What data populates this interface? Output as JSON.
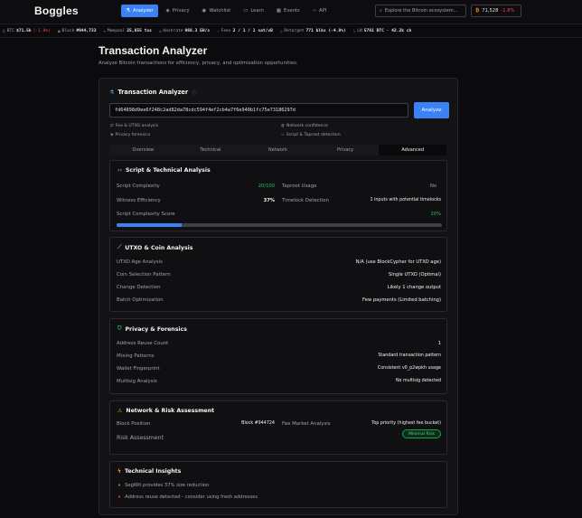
{
  "nav": {
    "logo": "Boggles",
    "links": [
      {
        "label": "Analyzer",
        "icon": "flask"
      },
      {
        "label": "Privacy",
        "icon": "shield"
      },
      {
        "label": "Watchlist",
        "icon": "eye"
      },
      {
        "label": "Learn",
        "icon": "book"
      },
      {
        "label": "Events",
        "icon": "calendar"
      },
      {
        "label": "API",
        "icon": "code"
      }
    ],
    "search_placeholder": "Explore the Bitcoin ecosystem...",
    "price": "71,528",
    "price_change": "-1.8%"
  },
  "ticker": {
    "btc_label": "BTC",
    "btc_value": "$71.5k",
    "btc_change": "(-1.8%)",
    "block_label": "Block",
    "block_value": "#944,733",
    "mempool_label": "Mempool",
    "mempool_value": "25,655 txs",
    "hashrate_label": "Hashrate",
    "hashrate_value": "968.3 EH/s",
    "fees_label": "Fees",
    "fees_value": "2 / 1 / 1 sat/vB",
    "retarget_label": "Retarget",
    "retarget_value": "771 blks (-4.8%)",
    "ln_label": "LN",
    "ln_value": "5781 BTC · 42.2k ch"
  },
  "page": {
    "title": "Transaction Analyzer",
    "subtitle": "Analyze Bitcoin transactions for efficiency, privacy, and optimization opportunities."
  },
  "analyzer": {
    "title": "Transaction Analyzer",
    "txid": "fd64898d9ee6f248c2ad82da78cdc594f4ef2cb4a7f6e940b1fc75e73186297d",
    "analyze_label": "Analyze",
    "features": [
      "Fee & UTXO analysis",
      "Network confidence",
      "Privacy forensics",
      "Script & Taproot detection"
    ],
    "tabs": [
      "Overview",
      "Technical",
      "Network",
      "Privacy",
      "Advanced"
    ],
    "active_tab": "Advanced"
  },
  "script": {
    "title": "Script & Technical Analysis",
    "complexity_label": "Script Complexity",
    "complexity_value": "20/100",
    "taproot_label": "Taproot Usage",
    "taproot_value": "No",
    "witness_label": "Witness Efficiency",
    "witness_value": "37%",
    "timelock_label": "Timelock Detection",
    "timelock_value": "1 inputs with potential timelocks",
    "score_label": "Script Complexity Score",
    "score_value": "20%",
    "score_fraction": 0.2
  },
  "utxo": {
    "title": "UTXO & Coin Analysis",
    "rows": [
      {
        "label": "UTXO Age Analysis",
        "value": "N/A (use BlockCypher for UTXO age)"
      },
      {
        "label": "Coin Selection Pattern",
        "value": "Single UTXO (Optimal)"
      },
      {
        "label": "Change Detection",
        "value": "Likely 1 change output"
      },
      {
        "label": "Batch Optimization",
        "value": "Few payments (Limited batching)"
      }
    ]
  },
  "privacy": {
    "title": "Privacy & Forensics",
    "rows": [
      {
        "label": "Address Reuse Count",
        "value": "1"
      },
      {
        "label": "Mixing Patterns",
        "value": "Standard transaction pattern"
      },
      {
        "label": "Wallet Fingerprint",
        "value": "Consistent v0_p2wpkh usage"
      },
      {
        "label": "Multisig Analysis",
        "value": "No multisig detected"
      }
    ]
  },
  "risk": {
    "title": "Network & Risk Assessment",
    "block_label": "Block Position",
    "block_value": "Block #944724",
    "fee_label": "Fee Market Analysis",
    "fee_value": "Top priority (highest fee bucket)",
    "risk_label": "Risk Assessment",
    "risk_value": "Minimal Risk"
  },
  "insights": {
    "title": "Technical Insights",
    "items": [
      "SegWit provides 37% size reduction",
      "Address reuse detected - consider using fresh addresses"
    ]
  },
  "colors": {
    "accent": "#3b82f6",
    "bitcoin": "#f7931a",
    "negative": "#ef4444",
    "positive": "#22c55e",
    "warning": "#f59e0b"
  }
}
